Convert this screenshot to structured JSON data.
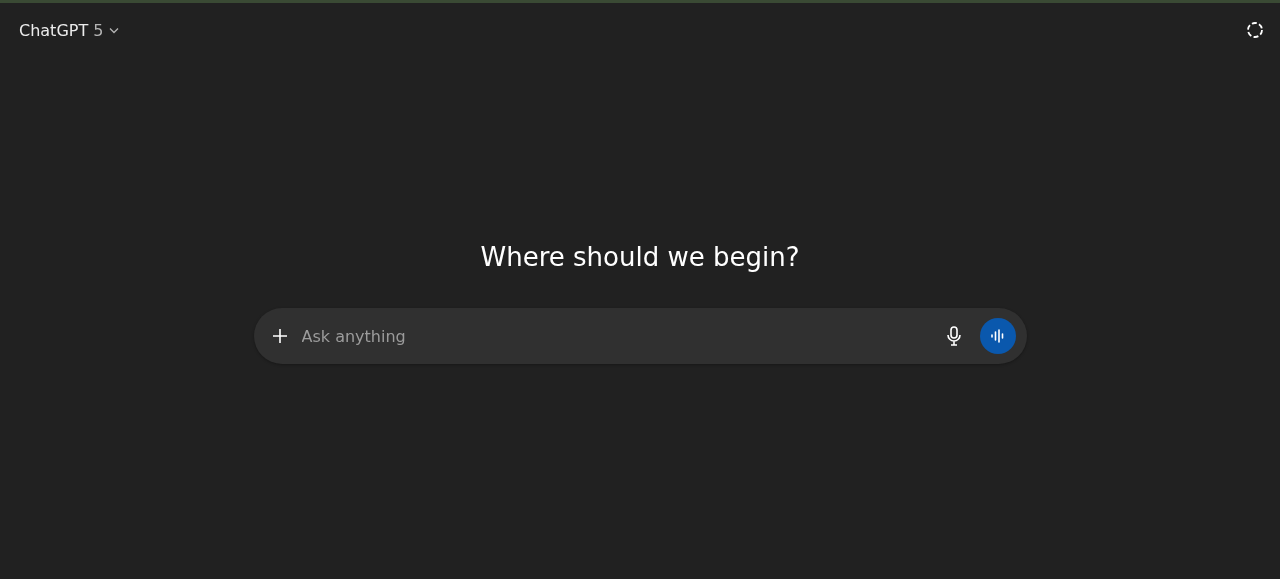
{
  "header": {
    "model_name": "ChatGPT",
    "model_version": "5"
  },
  "heading": "Where should we begin?",
  "composer": {
    "placeholder": "Ask anything"
  }
}
